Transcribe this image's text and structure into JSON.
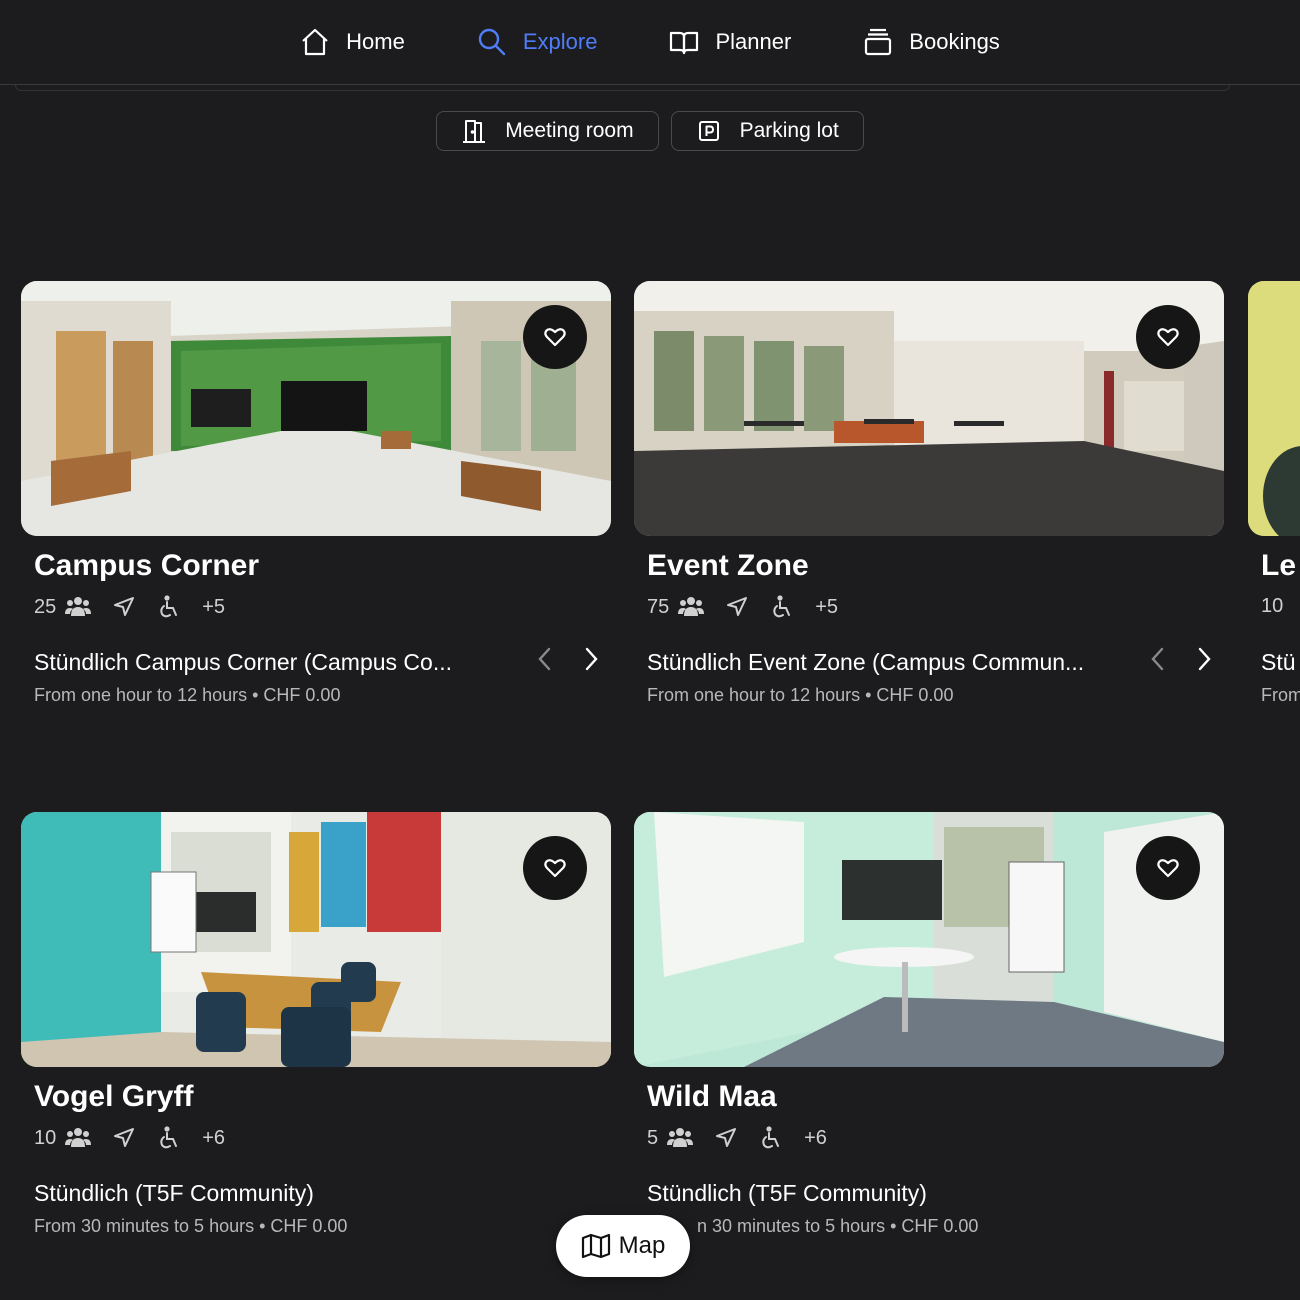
{
  "nav": {
    "items": [
      {
        "label": "Home",
        "icon": "home-icon",
        "active": false
      },
      {
        "label": "Explore",
        "icon": "search-icon",
        "active": true
      },
      {
        "label": "Planner",
        "icon": "book-icon",
        "active": false
      },
      {
        "label": "Bookings",
        "icon": "stack-icon",
        "active": false
      }
    ],
    "accent_color": "#4f7df5"
  },
  "filters": [
    {
      "label": "Meeting room",
      "icon": "door-icon"
    },
    {
      "label": "Parking lot",
      "icon": "parking-icon"
    }
  ],
  "cards": [
    {
      "title": "Campus Corner",
      "capacity": "25",
      "extra_features": "+5",
      "rate_name": "Stündlich Campus Corner (Campus Co...",
      "rate_details": "From one hour to 12 hours • CHF 0.00",
      "has_rate_arrows": true
    },
    {
      "title": "Event Zone",
      "capacity": "75",
      "extra_features": "+5",
      "rate_name": "Stündlich Event Zone (Campus Commun...",
      "rate_details": "From one hour to 12 hours • CHF 0.00",
      "has_rate_arrows": true
    },
    {
      "title": "Le",
      "capacity": "10",
      "rate_name": "Stü",
      "rate_details": "From"
    },
    {
      "title": "Vogel Gryff",
      "capacity": "10",
      "extra_features": "+6",
      "rate_name": "Stündlich (T5F Community)",
      "rate_details": "From 30 minutes to 5 hours • CHF 0.00",
      "has_rate_arrows": false
    },
    {
      "title": "Wild Maa",
      "capacity": "5",
      "extra_features": "+6",
      "rate_name": "Stündlich (T5F Community)",
      "rate_details": "n 30 minutes to 5 hours • CHF 0.00",
      "has_rate_arrows": false
    }
  ],
  "map_button": {
    "label": "Map",
    "icon": "map-icon"
  }
}
